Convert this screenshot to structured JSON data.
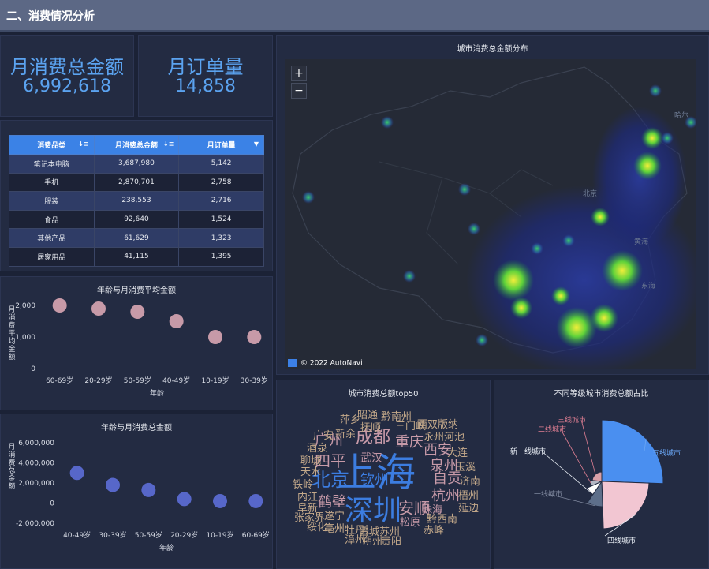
{
  "header": {
    "title": "二、消费情况分析"
  },
  "kpis": {
    "total_amount": {
      "label": "月消费总金额",
      "value": "6,992,618"
    },
    "orders": {
      "label": "月订单量",
      "value": "14,858"
    }
  },
  "category_table": {
    "columns": [
      "消费品类",
      "月消费总金额",
      "月订单量"
    ],
    "rows": [
      [
        "笔记本电脑",
        "3,687,980",
        "5,142"
      ],
      [
        "手机",
        "2,870,701",
        "2,758"
      ],
      [
        "服装",
        "238,553",
        "2,716"
      ],
      [
        "食品",
        "92,640",
        "1,524"
      ],
      [
        "其他产品",
        "61,629",
        "1,323"
      ],
      [
        "居家用品",
        "41,115",
        "1,395"
      ]
    ]
  },
  "map": {
    "title": "城市消费总金额分布",
    "zoom_in": "+",
    "zoom_out": "−",
    "credit": "© 2022 AutoNavi",
    "labels": {
      "beijing": "北京",
      "huanghai": "黄海",
      "donghai": "东海",
      "haerbin": "哈尔"
    }
  },
  "chart_avg": {
    "title": "年龄与月消费平均金额",
    "xlabel": "年龄",
    "ylabel": "月消费平均金额",
    "yticks": [
      "2,000",
      "1,000",
      "0"
    ],
    "color": "#c79aa8",
    "chart_data": {
      "type": "scatter",
      "categories": [
        "60-69岁",
        "20-29岁",
        "50-59岁",
        "40-49岁",
        "10-19岁",
        "30-39岁"
      ],
      "values": [
        2000,
        1900,
        1800,
        1500,
        1000,
        1000
      ],
      "ylim": [
        0,
        2000
      ]
    }
  },
  "chart_total": {
    "title": "年龄与月消费总金额",
    "xlabel": "年龄",
    "ylabel": "月消费总金额",
    "yticks": [
      "6,000,000",
      "4,000,000",
      "2,000,000",
      "0",
      "-2,000,000"
    ],
    "color": "#5767c9",
    "chart_data": {
      "type": "scatter",
      "categories": [
        "40-49岁",
        "30-39岁",
        "50-59岁",
        "20-29岁",
        "10-19岁",
        "60-69岁"
      ],
      "values": [
        3000000,
        1800000,
        1300000,
        400000,
        200000,
        200000
      ],
      "ylim": [
        -2000000,
        6000000
      ]
    }
  },
  "wordcloud": {
    "title": "城市消费总额top50",
    "words": [
      {
        "t": "上海",
        "c": "#3c7de0"
      },
      {
        "t": "深圳",
        "c": "#3c7de0"
      },
      {
        "t": "北京",
        "c": "#3c7de0"
      },
      {
        "t": "成都",
        "c": "#c79aa8"
      },
      {
        "t": "重庆",
        "c": "#c79aa8"
      },
      {
        "t": "四平",
        "c": "#c79aa8"
      },
      {
        "t": "广州",
        "c": "#c79aa8"
      },
      {
        "t": "钦州",
        "c": "#3c7de0"
      },
      {
        "t": "安顺",
        "c": "#c79aa8"
      },
      {
        "t": "泉州",
        "c": "#c79aa8"
      },
      {
        "t": "自贡",
        "c": "#c79aa8"
      },
      {
        "t": "杭州",
        "c": "#c79aa8"
      },
      {
        "t": "西安",
        "c": "#c79aa8"
      },
      {
        "t": "鹤壁",
        "c": "#c79aa8"
      },
      {
        "t": "武汉",
        "c": "#c79aa8"
      },
      {
        "t": "昭通",
        "c": "#c4a98a"
      },
      {
        "t": "黔南州",
        "c": "#c4a98a"
      },
      {
        "t": "萍乡",
        "c": "#c4a98a"
      },
      {
        "t": "抚顺",
        "c": "#c4a98a"
      },
      {
        "t": "三门峡",
        "c": "#c4a98a"
      },
      {
        "t": "西双版纳",
        "c": "#c4a98a"
      },
      {
        "t": "广安",
        "c": "#c4a98a"
      },
      {
        "t": "新余",
        "c": "#c4a98a"
      },
      {
        "t": "永州",
        "c": "#c4a98a"
      },
      {
        "t": "河池",
        "c": "#c4a98a"
      },
      {
        "t": "酒泉",
        "c": "#c4a98a"
      },
      {
        "t": "大连",
        "c": "#c4a98a"
      },
      {
        "t": "聊城",
        "c": "#c4a98a"
      },
      {
        "t": "玉溪",
        "c": "#c4a98a"
      },
      {
        "t": "天水",
        "c": "#c4a98a"
      },
      {
        "t": "铁岭",
        "c": "#c4a98a"
      },
      {
        "t": "济南",
        "c": "#c4a98a"
      },
      {
        "t": "内江",
        "c": "#c4a98a"
      },
      {
        "t": "梧州",
        "c": "#c4a98a"
      },
      {
        "t": "阜新",
        "c": "#c4a98a"
      },
      {
        "t": "珠海",
        "c": "#c79aa8"
      },
      {
        "t": "延边",
        "c": "#c4a98a"
      },
      {
        "t": "张家界",
        "c": "#c4a98a"
      },
      {
        "t": "遂宁",
        "c": "#c4a98a"
      },
      {
        "t": "松原",
        "c": "#c79aa8"
      },
      {
        "t": "黔西南",
        "c": "#c4a98a"
      },
      {
        "t": "绥化",
        "c": "#c4a98a"
      },
      {
        "t": "亳州",
        "c": "#c4a98a"
      },
      {
        "t": "赤峰",
        "c": "#c4a98a"
      },
      {
        "t": "牡丹江",
        "c": "#c4a98a"
      },
      {
        "t": "晋城",
        "c": "#c4a98a"
      },
      {
        "t": "苏州",
        "c": "#c4a98a"
      },
      {
        "t": "漳州",
        "c": "#c4a98a"
      },
      {
        "t": "朔州",
        "c": "#c4a98a"
      },
      {
        "t": "贵阳",
        "c": "#c4a98a"
      }
    ]
  },
  "pie": {
    "title": "不同等级城市消费总额占比",
    "chart_data": {
      "type": "pie",
      "labels": [
        "五线城市",
        "四线城市",
        "一线城市",
        "新一线城市",
        "二线城市",
        "三线城市"
      ],
      "values": [
        41,
        33,
        9,
        6,
        6,
        5
      ],
      "colors": [
        "#4a8ff0",
        "#f2c6d2",
        "#5e6f8a",
        "#ffffff",
        "#b3b7c4",
        "#d8a0a8"
      ],
      "label_colors": [
        "#6aa6f5",
        "#e9eef5",
        "#7d869c",
        "#e9eef5",
        "#e07f93",
        "#e07f93"
      ]
    }
  }
}
